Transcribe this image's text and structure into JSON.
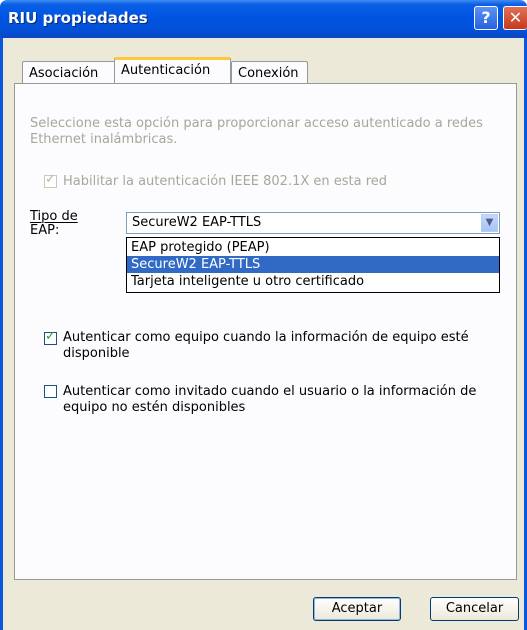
{
  "window": {
    "title": "RIU propiedades",
    "help_glyph": "?",
    "close_glyph": "✕"
  },
  "tabs": [
    {
      "label": "Asociación",
      "active": false
    },
    {
      "label": "Autenticación",
      "active": true
    },
    {
      "label": "Conexión",
      "active": false
    }
  ],
  "auth": {
    "description": "Seleccione esta opción para proporcionar acceso autenticado a redes Ethernet inalámbricas.",
    "enable_8021x": {
      "label": "Habilitar la autenticación IEEE 802.1X en esta red",
      "checked": true,
      "enabled": false
    },
    "eap_type_label_line1": "Tipo de",
    "eap_type_label_line2": "EAP:",
    "eap_selected": "SecureW2 EAP-TTLS",
    "eap_options": [
      "EAP protegido (PEAP)",
      "SecureW2 EAP-TTLS",
      "Tarjeta inteligente u otro certificado"
    ],
    "eap_highlighted_index": 1,
    "computer_auth": {
      "label": "Autenticar como equipo cuando la información de equipo esté disponible",
      "checked": true
    },
    "guest_auth": {
      "label": "Autenticar como invitado cuando el usuario o la información de equipo no estén disponibles",
      "checked": false
    }
  },
  "buttons": {
    "ok": "Aceptar",
    "cancel": "Cancelar"
  },
  "colors": {
    "titlebar": "#0054e3",
    "selection": "#316ac5",
    "tab_highlight": "#ffc73c"
  }
}
